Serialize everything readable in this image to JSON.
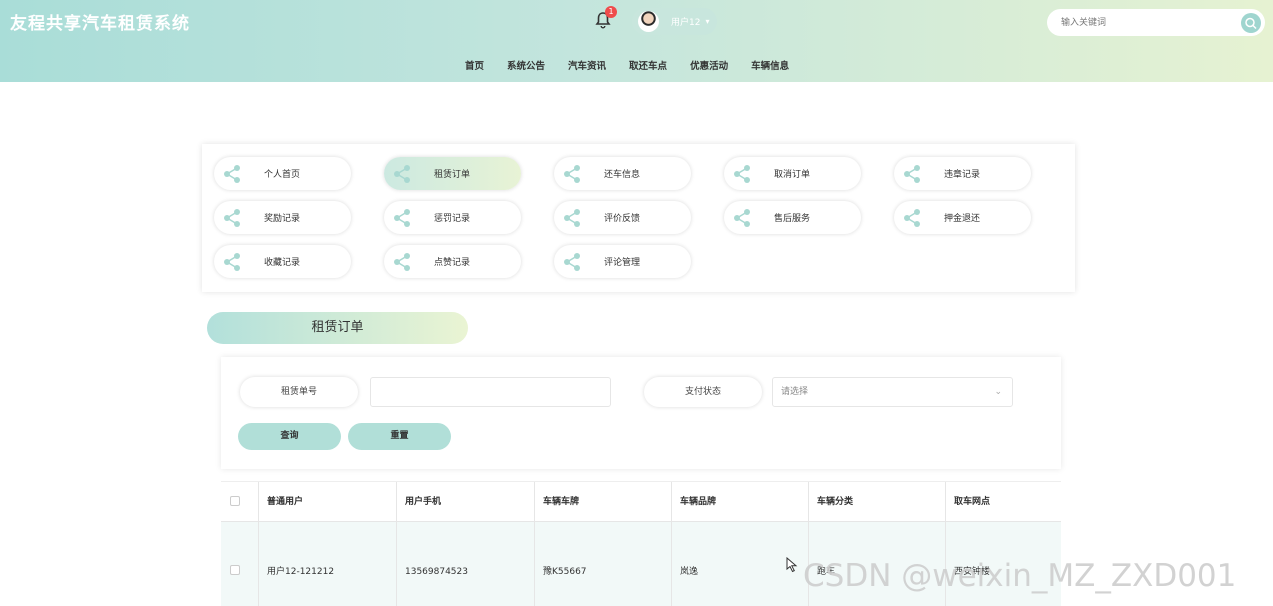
{
  "header": {
    "title": "友程共享汽车租赁系统",
    "notification_count": "1",
    "user_name": "用户12",
    "search_placeholder": "输入关键词"
  },
  "nav": [
    "首页",
    "系统公告",
    "汽车资讯",
    "取还车点",
    "优惠活动",
    "车辆信息"
  ],
  "menu": [
    {
      "label": "个人首页",
      "active": false
    },
    {
      "label": "租赁订单",
      "active": true
    },
    {
      "label": "还车信息",
      "active": false
    },
    {
      "label": "取消订单",
      "active": false
    },
    {
      "label": "违章记录",
      "active": false
    },
    {
      "label": "奖励记录",
      "active": false
    },
    {
      "label": "惩罚记录",
      "active": false
    },
    {
      "label": "评价反馈",
      "active": false
    },
    {
      "label": "售后服务",
      "active": false
    },
    {
      "label": "押金退还",
      "active": false
    },
    {
      "label": "收藏记录",
      "active": false
    },
    {
      "label": "点赞记录",
      "active": false
    },
    {
      "label": "评论管理",
      "active": false
    }
  ],
  "section_title": "租赁订单",
  "filter": {
    "order_no_label": "租赁单号",
    "order_no_value": "",
    "pay_status_label": "支付状态",
    "pay_status_value": "请选择",
    "query_button": "查询",
    "reset_button": "重置"
  },
  "table": {
    "columns": [
      "普通用户",
      "用户手机",
      "车辆车牌",
      "车辆品牌",
      "车辆分类",
      "取车网点"
    ],
    "rows": [
      [
        "用户12-121212",
        "13569874523",
        "豫K55667",
        "岚逸",
        "跑车",
        "西安钟楼"
      ]
    ]
  },
  "watermark": "CSDN @weixin_MZ_ZXD001",
  "colors": {
    "accent": "#b1dfd8",
    "header_start": "#a9ddd8",
    "header_end": "#e6f2d2",
    "badge": "#ef4c4c"
  }
}
